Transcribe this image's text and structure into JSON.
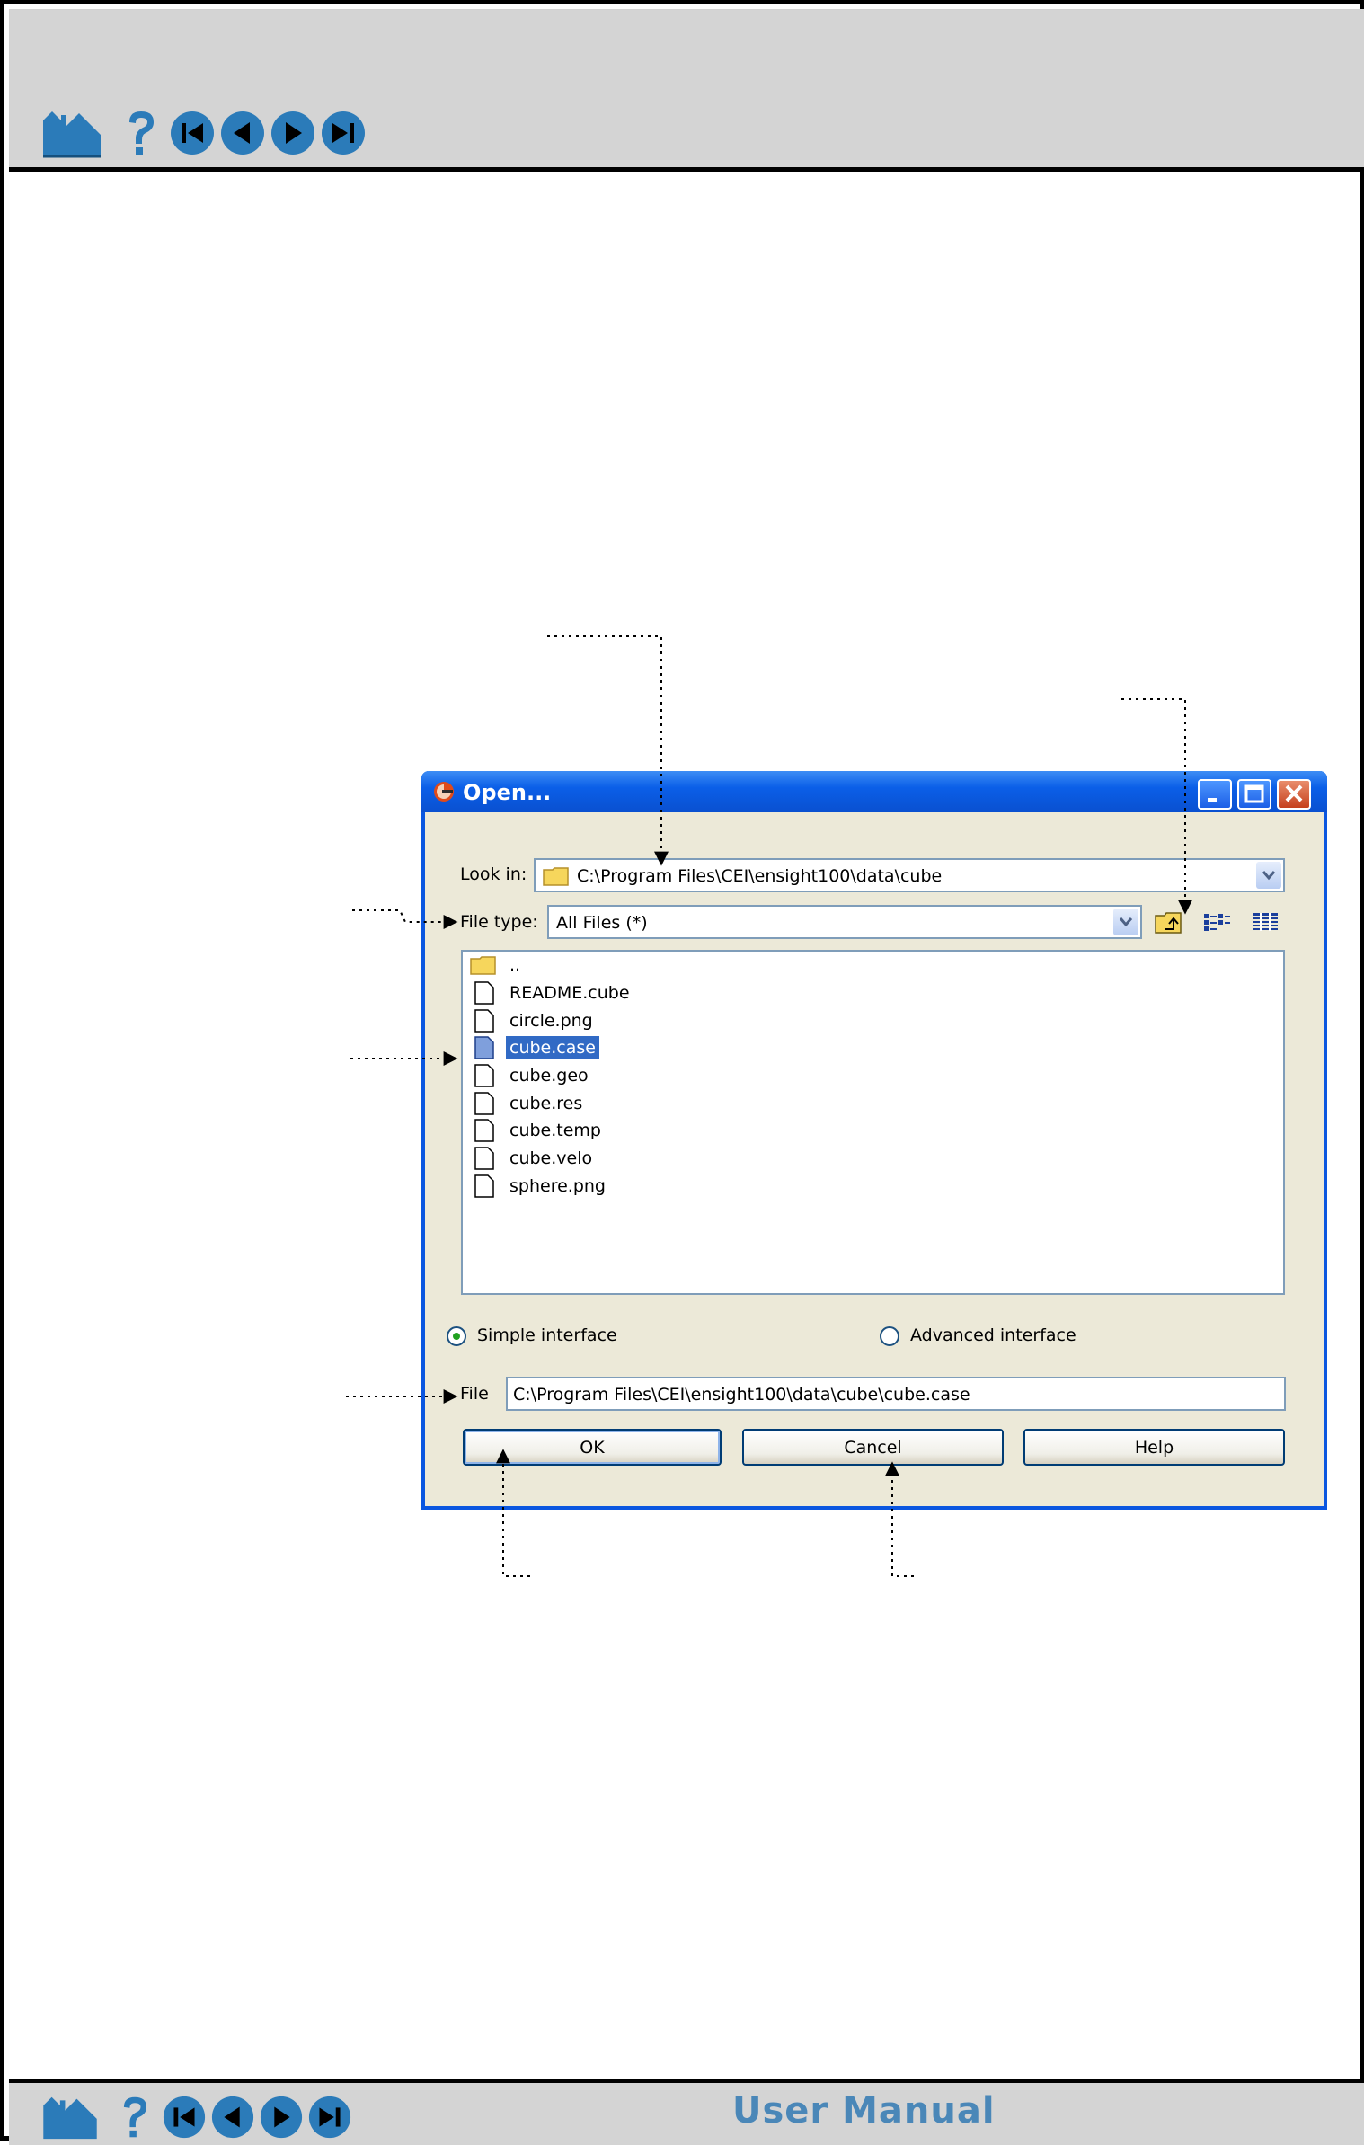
{
  "footer": {
    "manual_title": "User Manual"
  },
  "nav_icons": [
    "home-icon",
    "help-icon",
    "first-page-icon",
    "previous-page-icon",
    "next-page-icon",
    "last-page-icon"
  ],
  "dialog": {
    "title": "Open...",
    "look_in_label": "Look in:",
    "look_in_value": "C:\\Program Files\\CEI\\ensight100\\data\\cube",
    "file_type_label": "File type:",
    "file_type_value": "All Files (*)",
    "toolbar_icons": [
      "up-folder-icon",
      "list-view-icon",
      "details-view-icon"
    ],
    "files": [
      {
        "name": "..",
        "kind": "folder",
        "selected": false
      },
      {
        "name": "README.cube",
        "kind": "file",
        "selected": false
      },
      {
        "name": "circle.png",
        "kind": "file",
        "selected": false
      },
      {
        "name": "cube.case",
        "kind": "file",
        "selected": true
      },
      {
        "name": "cube.geo",
        "kind": "file",
        "selected": false
      },
      {
        "name": "cube.res",
        "kind": "file",
        "selected": false
      },
      {
        "name": "cube.temp",
        "kind": "file",
        "selected": false
      },
      {
        "name": "cube.velo",
        "kind": "file",
        "selected": false
      },
      {
        "name": "sphere.png",
        "kind": "file",
        "selected": false
      }
    ],
    "simple_interface_label": "Simple interface",
    "simple_interface_selected": true,
    "advanced_interface_label": "Advanced interface",
    "advanced_interface_selected": false,
    "file_label": "File",
    "file_value": "C:\\Program Files\\CEI\\ensight100\\data\\cube\\cube.case",
    "ok_label": "OK",
    "cancel_label": "Cancel",
    "help_label": "Help"
  },
  "colors": {
    "titlebar": "#0b5fe8",
    "selection": "#316ac5",
    "dialog_bg": "#ece9d8",
    "banner_bg": "#d4d4d4",
    "manual_title": "#4a87b8"
  }
}
